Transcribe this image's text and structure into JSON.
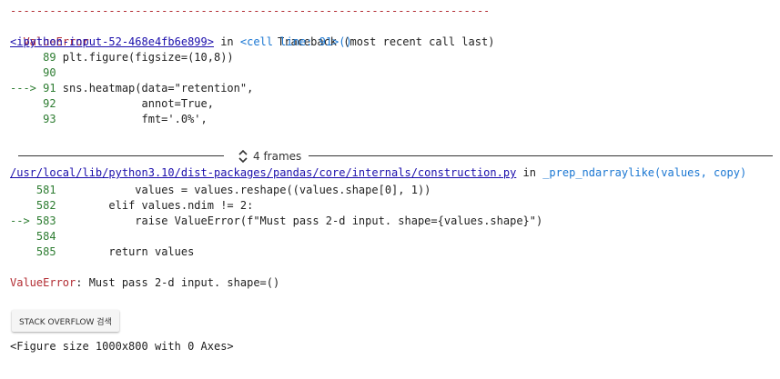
{
  "traceback": {
    "dashes": "---------------------------------------------------------------------------",
    "error_type": "ValueError",
    "header_right": "Traceback (most recent call last)",
    "frame1": {
      "file_link": "<ipython-input-52-468e4fb6e899>",
      "in_text": " in ",
      "location": "<cell line: 91>()",
      "lines": [
        {
          "prefix": "     ",
          "num": "89",
          "code": " plt.figure(figsize=(10,8))"
        },
        {
          "prefix": "     ",
          "num": "90",
          "code": ""
        },
        {
          "prefix": "---> ",
          "num": "91",
          "code": " sns.heatmap(data=\"retention\","
        },
        {
          "prefix": "     ",
          "num": "92",
          "code": "             annot=True,"
        },
        {
          "prefix": "     ",
          "num": "93",
          "code": "             fmt='.0%',"
        }
      ]
    },
    "frames_label": "4 frames",
    "frame2": {
      "file_link": "/usr/local/lib/python3.10/dist-packages/pandas/core/internals/construction.py",
      "in_text": " in ",
      "function": "_prep_ndarraylike(values, copy)",
      "lines": [
        {
          "prefix": "    ",
          "num": "581",
          "code": "            values = values.reshape((values.shape[0], 1))"
        },
        {
          "prefix": "    ",
          "num": "582",
          "code": "        elif values.ndim != 2:"
        },
        {
          "prefix": "--> ",
          "num": "583",
          "code": "            raise ValueError(f\"Must pass 2-d input. shape={values.shape}\")"
        },
        {
          "prefix": "    ",
          "num": "584",
          "code": ""
        },
        {
          "prefix": "    ",
          "num": "585",
          "code": "        return values"
        }
      ]
    },
    "error_name": "ValueError",
    "error_message": ": Must pass 2-d input. shape=()"
  },
  "button": {
    "label": "STACK OVERFLOW 검색"
  },
  "output": "<Figure size 1000x800 with 0 Axes>",
  "colors": {
    "error": "#b22b31",
    "lineno": "#2e7d32",
    "link": "#1a0dab",
    "location": "#1976d2"
  }
}
